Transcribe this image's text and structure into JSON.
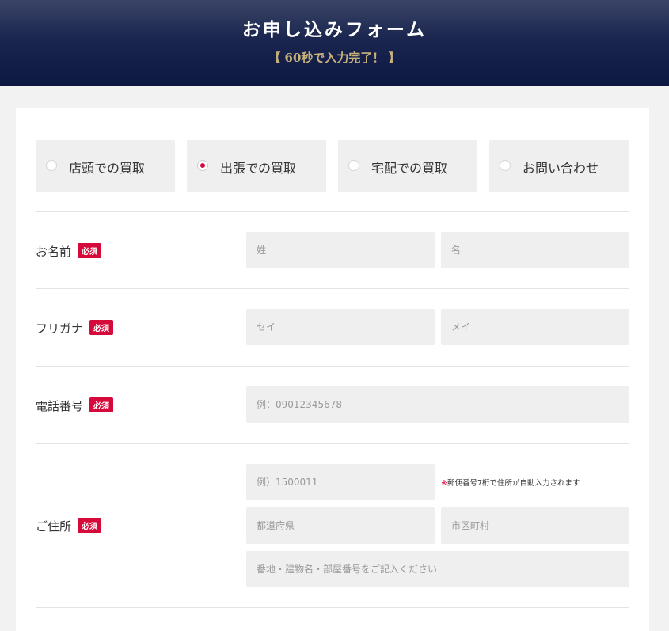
{
  "header": {
    "title": "お申し込みフォーム",
    "subtitle": "【 60秒で入力完了！ 】"
  },
  "purchase_type": {
    "options": [
      {
        "label": "店頭での買取",
        "checked": false
      },
      {
        "label": "出張での買取",
        "checked": true
      },
      {
        "label": "宅配での買取",
        "checked": false
      },
      {
        "label": "お問い合わせ",
        "checked": false
      }
    ]
  },
  "required_badge": "必須",
  "name": {
    "label": "お名前",
    "last_placeholder": "姓",
    "first_placeholder": "名"
  },
  "furigana": {
    "label": "フリガナ",
    "last_placeholder": "セイ",
    "first_placeholder": "メイ"
  },
  "phone": {
    "label": "電話番号",
    "placeholder": "例：09012345678"
  },
  "address": {
    "label": "ご住所",
    "postal_placeholder": "例）1500011",
    "postal_note_mark": "※",
    "postal_note": "郵便番号7桁で住所が自動入力されます",
    "prefecture_placeholder": "都道府県",
    "city_placeholder": "市区町村",
    "street_placeholder": "番地・建物名・部屋番号をご記入ください"
  },
  "colors": {
    "header_navy": "#0c1842",
    "gold": "#c8b27c",
    "required_red": "#d6093b",
    "field_bg": "#efefef"
  }
}
